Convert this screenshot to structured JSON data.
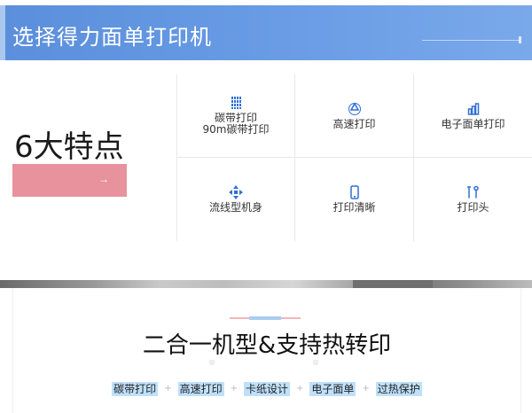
{
  "banner": {
    "title": "选择得力面单打印机"
  },
  "features": {
    "heading": "6大特点",
    "button_arrow": "→",
    "accent_color": "#e7929c",
    "icon_color": "#2f6fd6",
    "items": [
      {
        "label": "碳带打印",
        "sublabel": "90m碳带打印",
        "icon": "ribbon-icon"
      },
      {
        "label": "高速打印",
        "sublabel": "",
        "icon": "recycle-icon"
      },
      {
        "label": "电子面单打印",
        "sublabel": "",
        "icon": "bar-chart-icon"
      },
      {
        "label": "流线型机身",
        "sublabel": "",
        "icon": "move-arrows-icon"
      },
      {
        "label": "打印清晰",
        "sublabel": "",
        "icon": "phone-icon"
      },
      {
        "label": "打印头",
        "sublabel": "",
        "icon": "tools-icon"
      }
    ]
  },
  "product": {
    "heading": "二合一机型&支持热转印",
    "tags": [
      "碳带打印",
      "高速打印",
      "卡纸设计",
      "电子面单",
      "过热保护"
    ],
    "separator": "+",
    "tag_color": "#bfe0fb"
  }
}
